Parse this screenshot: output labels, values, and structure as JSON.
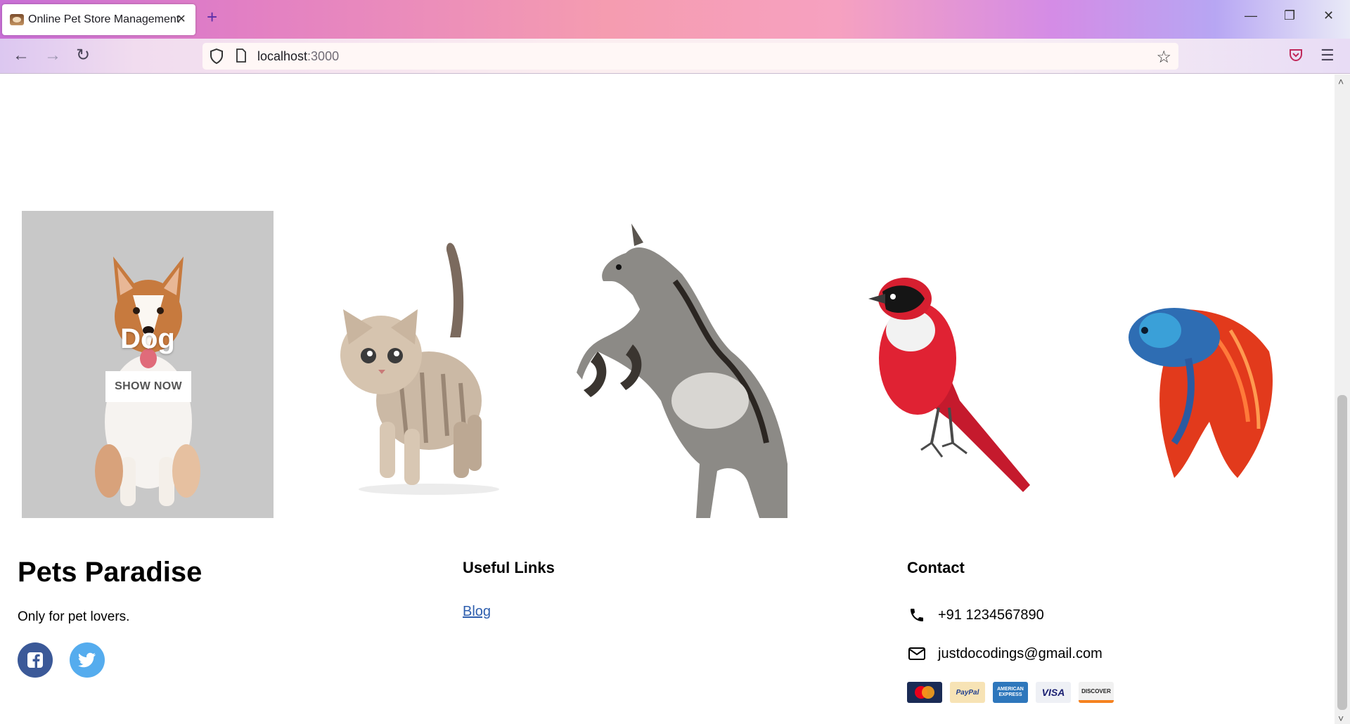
{
  "browser": {
    "tab_title": "Online Pet Store Management",
    "tab_close": "✕",
    "new_tab": "+",
    "url_host": "localhost",
    "url_port": ":3000",
    "controls": {
      "minimize": "—",
      "restore": "❐",
      "close": "✕"
    }
  },
  "hero": {
    "cards": [
      {
        "animal": "dog",
        "title": "Dog",
        "button": "SHOW NOW"
      },
      {
        "animal": "cat"
      },
      {
        "animal": "horse"
      },
      {
        "animal": "bird"
      },
      {
        "animal": "fish"
      }
    ]
  },
  "footer": {
    "brand": "Pets Paradise",
    "tagline": "Only for pet lovers.",
    "social": [
      "facebook-icon",
      "twitter-icon"
    ],
    "useful_links": {
      "heading": "Useful Links",
      "links": [
        "Blog"
      ]
    },
    "contact": {
      "heading": "Contact",
      "phone": "+91 1234567890",
      "email": "justdocodings@gmail.com"
    },
    "payments": [
      {
        "name": "mastercard",
        "color": "#1a1f71"
      },
      {
        "name": "paypal",
        "label": "PayPal",
        "color": "#f7e3b5"
      },
      {
        "name": "amex",
        "label": "AMERICAN EXPRESS",
        "color": "#2e77bc"
      },
      {
        "name": "visa",
        "label": "VISA",
        "color": "#eef0f5"
      },
      {
        "name": "discover",
        "label": "DISCOVER",
        "color": "#f1f1f1"
      }
    ]
  },
  "colors": {
    "facebook": "#3b5998",
    "twitter": "#55acee",
    "link": "#2f5fae"
  }
}
